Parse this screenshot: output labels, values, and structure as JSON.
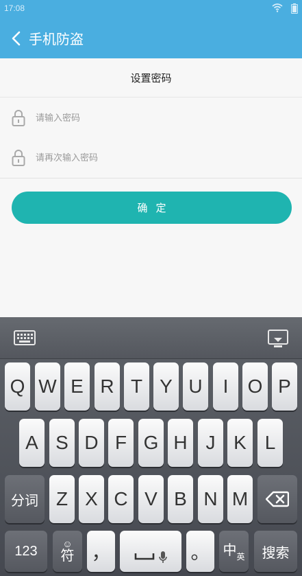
{
  "status_bar": {
    "time": "17:08",
    "wifi_icon": "wifi-icon",
    "battery_icon": "battery-icon"
  },
  "header": {
    "title": "手机防盗",
    "back_icon": "back-arrow-icon"
  },
  "section": {
    "title": "设置密码"
  },
  "fields": [
    {
      "placeholder": "请输入密码",
      "value": ""
    },
    {
      "placeholder": "请再次输入密码",
      "value": ""
    }
  ],
  "confirm_label": "确定",
  "colors": {
    "header": "#4aaee0",
    "button": "#1fb4b0",
    "keyboard": "#54575e"
  },
  "keyboard": {
    "row1": [
      "Q",
      "W",
      "E",
      "R",
      "T",
      "Y",
      "U",
      "I",
      "O",
      "P"
    ],
    "row2": [
      "A",
      "S",
      "D",
      "F",
      "G",
      "H",
      "J",
      "K",
      "L"
    ],
    "row3": [
      "Z",
      "X",
      "C",
      "V",
      "B",
      "N",
      "M"
    ],
    "split_label": "分词",
    "num_label": "123",
    "sym_label": "符",
    "comma_label": "，",
    "period_label": "。",
    "lang_label": "中",
    "lang_sub_label": "英",
    "search_label": "搜索"
  }
}
